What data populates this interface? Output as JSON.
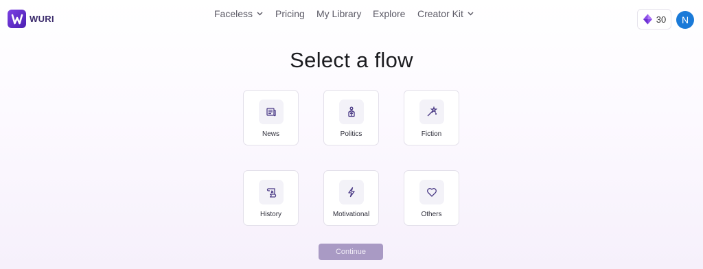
{
  "header": {
    "logo_text": "WURI",
    "nav": {
      "faceless": "Faceless",
      "pricing": "Pricing",
      "library": "My Library",
      "explore": "Explore",
      "creator_kit": "Creator Kit"
    },
    "credits": "30",
    "avatar_initial": "N"
  },
  "main": {
    "title": "Select a flow",
    "flows": [
      {
        "label": "News",
        "icon": "newspaper-icon"
      },
      {
        "label": "Politics",
        "icon": "podium-icon"
      },
      {
        "label": "Fiction",
        "icon": "magic-wand-icon"
      },
      {
        "label": "History",
        "icon": "scroll-icon"
      },
      {
        "label": "Motivational",
        "icon": "lightning-icon"
      },
      {
        "label": "Others",
        "icon": "heart-icon"
      }
    ],
    "continue_label": "Continue"
  },
  "colors": {
    "brand": "#5b2bc9",
    "icon_stroke": "#4a3a85",
    "avatar": "#1a7ad8",
    "continue_disabled": "#a99ac4"
  }
}
